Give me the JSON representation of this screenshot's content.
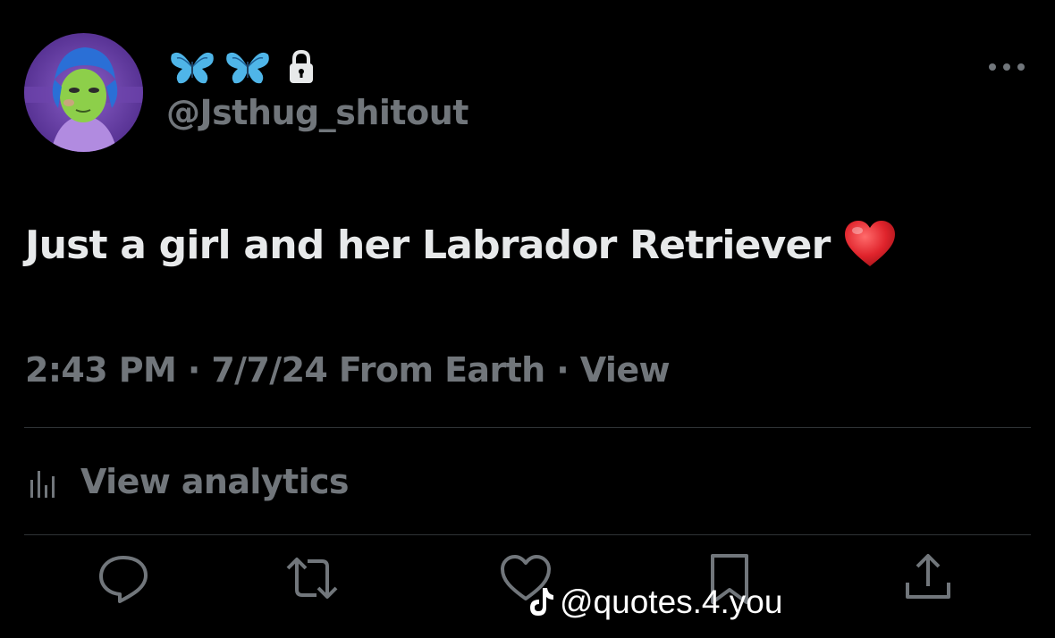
{
  "author": {
    "display_name_icons": [
      "butterfly-icon",
      "butterfly-icon",
      "lock-icon"
    ],
    "handle": "@Jsthug_shitout"
  },
  "tweet": {
    "text": "Just a girl and her Labrador Retriever",
    "emoji": "heart-emoji"
  },
  "meta": {
    "time": "2:43 PM",
    "sep1": " · ",
    "date": "7/7/24",
    "source": " From Earth",
    "sep2": " · ",
    "view": "View"
  },
  "analytics": {
    "label": "View analytics"
  },
  "actions": [
    "reply-icon",
    "retweet-icon",
    "like-icon",
    "bookmark-icon",
    "share-icon"
  ],
  "watermark": {
    "text": "@quotes.4.you"
  },
  "colors": {
    "background": "#000000",
    "primary_text": "#e7e9ea",
    "secondary_text": "#71767b",
    "divider": "#2f3336",
    "butterfly": "#4fb5e8",
    "heart": "#e0242c"
  }
}
